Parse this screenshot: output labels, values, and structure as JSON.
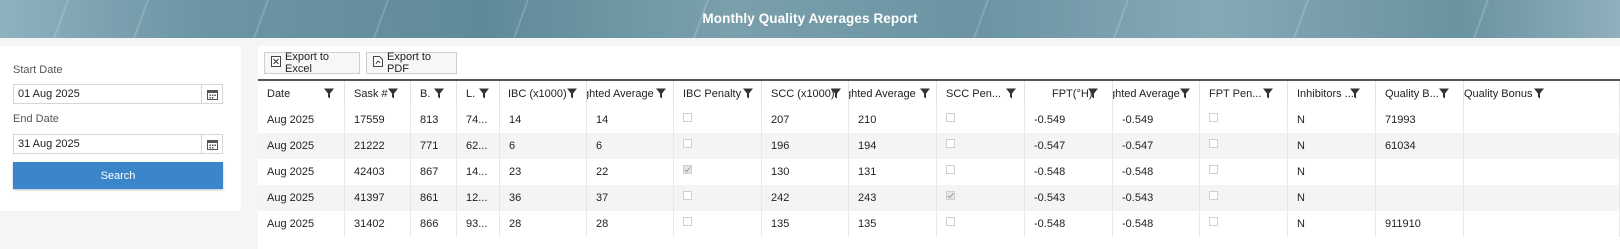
{
  "header": {
    "title": "Monthly Quality Averages Report"
  },
  "filters": {
    "start_label": "Start Date",
    "start_value": "01 Aug 2025",
    "end_label": "End Date",
    "end_value": "31 Aug 2025",
    "search_label": "Search"
  },
  "toolbar": {
    "excel_label": "Export to Excel",
    "pdf_label": "Export to PDF"
  },
  "columns": [
    "Date",
    "Sask #",
    "B.",
    "L.",
    "IBC (x1000)",
    "ghted Average",
    "IBC Penalty",
    "SCC (x1000)",
    "ghted Average",
    "SCC Pen...",
    "FPT(°H)",
    "ghted Average",
    "FPT Pen...",
    "Inhibitors ...",
    "Quality B...",
    "Quality Bonus"
  ],
  "rows": [
    [
      "Aug 2025",
      "17559",
      "813",
      "74...",
      "14",
      "14",
      false,
      "207",
      "210",
      false,
      "-0.549",
      "-0.549",
      false,
      "N",
      "71993",
      ""
    ],
    [
      "Aug 2025",
      "21222",
      "771",
      "62...",
      "6",
      "6",
      false,
      "196",
      "194",
      false,
      "-0.547",
      "-0.547",
      false,
      "N",
      "61034",
      ""
    ],
    [
      "Aug 2025",
      "42403",
      "867",
      "14...",
      "23",
      "22",
      true,
      "130",
      "131",
      false,
      "-0.548",
      "-0.548",
      false,
      "N",
      "",
      ""
    ],
    [
      "Aug 2025",
      "41397",
      "861",
      "12...",
      "36",
      "37",
      false,
      "242",
      "243",
      true,
      "-0.543",
      "-0.543",
      false,
      "N",
      "",
      ""
    ],
    [
      "Aug 2025",
      "31402",
      "866",
      "93...",
      "28",
      "28",
      false,
      "135",
      "135",
      false,
      "-0.548",
      "-0.548",
      false,
      "N",
      "911910",
      ""
    ]
  ]
}
